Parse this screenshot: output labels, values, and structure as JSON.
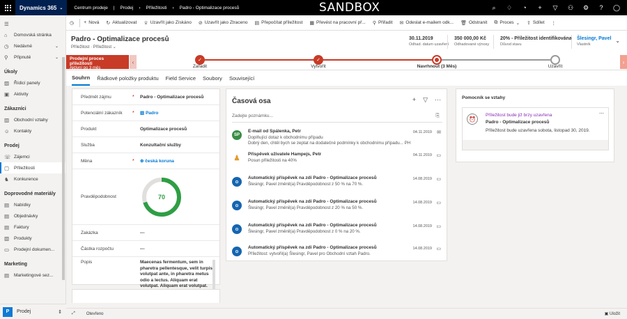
{
  "topbar": {
    "app_name": "Dynamics 365",
    "app_switcher": "Centrum prodeje",
    "breadcrumb": [
      "Prodej",
      "Příležitosti",
      "Padro - Optimalizace procesů"
    ],
    "environment": "SANDBOX",
    "icons": [
      "search-icon",
      "lightbulb-icon",
      "assistant-icon",
      "add-icon",
      "filter-icon",
      "people-icon",
      "settings-icon",
      "help-icon",
      "user-icon"
    ]
  },
  "commands": [
    {
      "icon": "add-icon",
      "label": "Nová"
    },
    {
      "icon": "refresh-icon",
      "label": "Aktualizovat"
    },
    {
      "icon": "trophy-icon",
      "label": "Uzavřít jako Získáno"
    },
    {
      "icon": "cancel-icon",
      "label": "Uzavřít jako Ztraceno"
    },
    {
      "icon": "calculator-icon",
      "label": "Přepočítat příležitost"
    },
    {
      "icon": "workitem-icon",
      "label": "Převést na pracovní př..."
    },
    {
      "icon": "assign-icon",
      "label": "Přiřadit"
    },
    {
      "icon": "email-icon",
      "label": "Odeslat e-mailem odk..."
    },
    {
      "icon": "delete-icon",
      "label": "Odstranit"
    },
    {
      "icon": "process-icon",
      "label": "Proces"
    },
    {
      "icon": "share-icon",
      "label": "Sdílet"
    }
  ],
  "sidebar": {
    "top": [
      {
        "icon": "home-icon",
        "label": "Domovská stránka"
      },
      {
        "icon": "clock-icon",
        "label": "Nedávné"
      },
      {
        "icon": "pin-icon",
        "label": "Připnuté"
      }
    ],
    "sections": [
      {
        "title": "Úkoly",
        "items": [
          {
            "icon": "dashboard-icon",
            "label": "Řídicí panely"
          },
          {
            "icon": "activities-icon",
            "label": "Aktivity"
          }
        ]
      },
      {
        "title": "Zákazníci",
        "items": [
          {
            "icon": "account-icon",
            "label": "Obchodní vztahy"
          },
          {
            "icon": "contact-icon",
            "label": "Kontakty"
          }
        ]
      },
      {
        "title": "Prodej",
        "items": [
          {
            "icon": "lead-icon",
            "label": "Zájemci"
          },
          {
            "icon": "opportunity-icon",
            "label": "Příležitosti",
            "active": true
          },
          {
            "icon": "competitor-icon",
            "label": "Konkurence"
          }
        ]
      },
      {
        "title": "Doprovodné materiály",
        "items": [
          {
            "icon": "quote-icon",
            "label": "Nabídky"
          },
          {
            "icon": "order-icon",
            "label": "Objednávky"
          },
          {
            "icon": "invoice-icon",
            "label": "Faktury"
          },
          {
            "icon": "product-icon",
            "label": "Produkty"
          },
          {
            "icon": "document-icon",
            "label": "Prodejní dokumen..."
          }
        ]
      },
      {
        "title": "Marketing",
        "items": [
          {
            "icon": "marketing-icon",
            "label": "Marketingové sez..."
          }
        ]
      }
    ],
    "area": {
      "badge": "P",
      "label": "Prodej"
    }
  },
  "header": {
    "title": "Padro - Optimalizace procesů",
    "entity": "Příležitost",
    "form": "Příležitost",
    "fields": [
      {
        "value": "30.11.2019",
        "label": "Odhad. datum uzavření"
      },
      {
        "value": "350 000,00 Kč",
        "label": "Odhadované výnosy"
      },
      {
        "value": "20% - Příležitost identifikována",
        "label": "Důvod stavu"
      },
      {
        "value": "Šlesingr, Pavel",
        "label": "Vlastník"
      }
    ]
  },
  "process": {
    "name": "Prodejní proces příležitosti",
    "duration": "Aktivní po 3 měs",
    "stages": [
      {
        "label": "Zařadit",
        "state": "done"
      },
      {
        "label": "Vytvořit",
        "state": "done"
      },
      {
        "label": "Navrhnout (3 Měs)",
        "state": "active"
      },
      {
        "label": "Uzavřít",
        "state": "todo"
      }
    ]
  },
  "tabs": [
    "Souhrn",
    "Řádkové položky produktu",
    "Field Service",
    "Soubory",
    "Související"
  ],
  "summary": {
    "topic_label": "Předmět zájmu",
    "topic": "Padro - Optimalizace procesů",
    "customer_label": "Potenciální zákazník",
    "customer": "Padro",
    "product_label": "Produkt",
    "product": "Optimalizace procesů",
    "service_label": "Služba",
    "service": "Konzultační služby",
    "currency_label": "Měna",
    "currency": "česká koruna",
    "probability_label": "Pravděpodobnost",
    "probability": 70,
    "deposit_label": "Zakázka",
    "deposit": "---",
    "budget_label": "Částka rozpočtu",
    "budget": "---",
    "description_label": "Popis",
    "description": "Maecenas fermentum, sem in pharetra pellentesque, velit turpis volutpat ante, in pharetra metus odio a lectus. Aliquam erat volutpat. Aliquam erat volutpat."
  },
  "timeline": {
    "title": "Časová osa",
    "note_placeholder": "Zadejte poznámku...",
    "items": [
      {
        "avatar": "SP",
        "title": "E-mail od Spálenka, Petr",
        "line1": "Doplňující dotaz k obchodnímu případu",
        "line2": "Dobrý den, chtěl bych se zeptat na dodatečné podmínky k obchodnímu případu... PH",
        "date": "04.11.2019"
      },
      {
        "avatar": "person",
        "title": "Příspěvek uživatele Hampejs, Petr",
        "line1": "Posun příležitosti na 40%",
        "line2": "",
        "date": "04.11.2019"
      },
      {
        "avatar": "bot",
        "title": "Automatický příspěvek na zdi Padro - Optimalizace procesů",
        "line1": "Šlesingr, Pavel změnil(a) Pravděpodobnost z 50 % na 70 %.",
        "line2": "",
        "date": "14.08.2019"
      },
      {
        "avatar": "bot",
        "title": "Automatický příspěvek na zdi Padro - Optimalizace procesů",
        "line1": "Šlesingr, Pavel změnil(a) Pravděpodobnost z 20 % na 50 %.",
        "line2": "",
        "date": "14.08.2019"
      },
      {
        "avatar": "bot",
        "title": "Automatický příspěvek na zdi Padro - Optimalizace procesů",
        "line1": "Šlesingr, Pavel změnil(a) Pravděpodobnost z 0 % na 20 %.",
        "line2": "",
        "date": "14.08.2019"
      },
      {
        "avatar": "bot",
        "title": "Automatický příspěvek na zdi Padro - Optimalizace procesů",
        "line1": "Příležitost: vytvořil(a) Šlesingr, Pavel pro Obchodní vztah Padro.",
        "line2": "",
        "date": "14.08.2019"
      }
    ]
  },
  "assistant": {
    "title": "Pomocník se vztahy",
    "card_heading": "Příležitost bude již brzy uzavřena",
    "card_title": "Padro - Optimalizace procesů",
    "card_text": "Příležitost bude uzavřena sobota, listopad 30, 2019."
  },
  "footer": {
    "status": "Otevřeno",
    "save": "Uložit"
  },
  "colors": {
    "accent": "#0078d4",
    "process": "#c83b27",
    "probability": "#2e9e44"
  }
}
